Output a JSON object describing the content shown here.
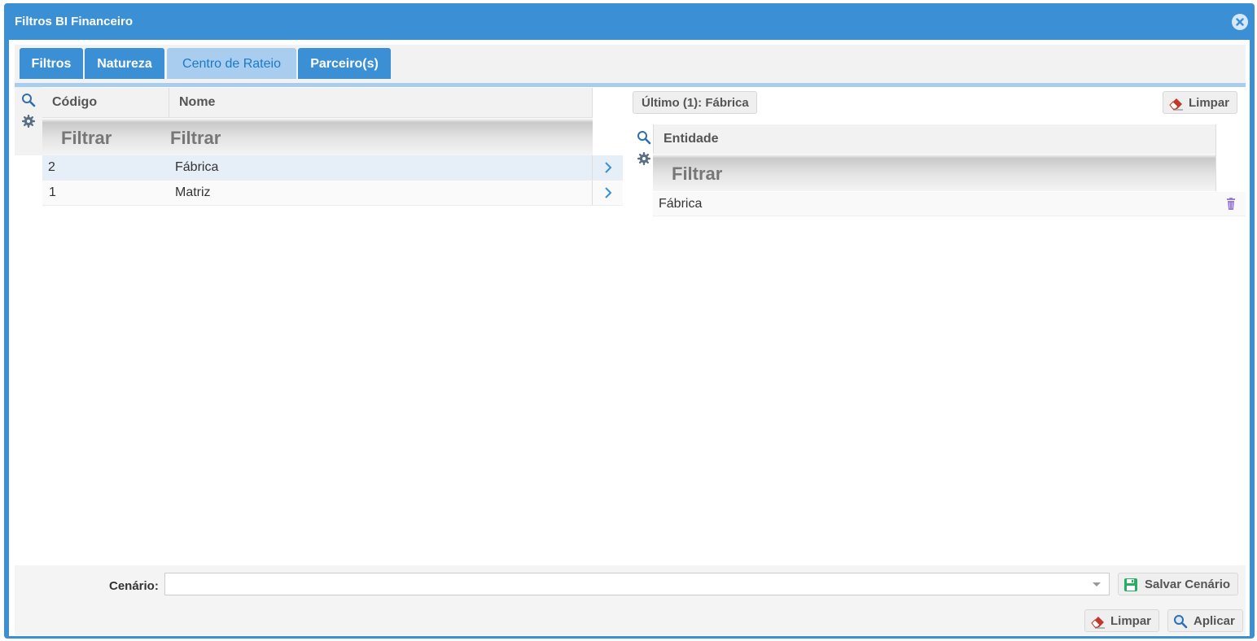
{
  "dialog": {
    "title": "Filtros BI Financeiro"
  },
  "tabs": [
    {
      "label": "Filtros",
      "active": false
    },
    {
      "label": "Natureza",
      "active": false
    },
    {
      "label": "Centro de Rateio",
      "active": true
    },
    {
      "label": "Parceiro(s)",
      "active": false
    }
  ],
  "left_grid": {
    "columns": [
      "Código",
      "Nome"
    ],
    "filter_placeholders": [
      "Filtrar",
      "Filtrar"
    ],
    "rows": [
      {
        "codigo": "2",
        "nome": "Fábrica",
        "selected": true
      },
      {
        "codigo": "1",
        "nome": "Matriz",
        "selected": false
      }
    ]
  },
  "right_panel": {
    "last_button": "Último (1): Fábrica",
    "clear_button": "Limpar",
    "column": "Entidade",
    "filter_placeholder": "Filtrar",
    "rows": [
      {
        "entidade": "Fábrica"
      }
    ]
  },
  "footer": {
    "scenario_label": "Cenário:",
    "scenario_value": "",
    "save_button": "Salvar Cenário",
    "clear_button": "Limpar",
    "apply_button": "Aplicar"
  },
  "colors": {
    "primary": "#3a8fd5",
    "tab_active_bg": "#a9cdef",
    "eraser_red": "#c0392b",
    "save_green": "#27ae60",
    "trash_purple": "#9b7fd4"
  },
  "icons": [
    "close-icon",
    "search-icon",
    "gear-icon",
    "chevron-right-icon",
    "eraser-icon",
    "trash-icon",
    "save-icon",
    "dropdown-caret-icon"
  ]
}
